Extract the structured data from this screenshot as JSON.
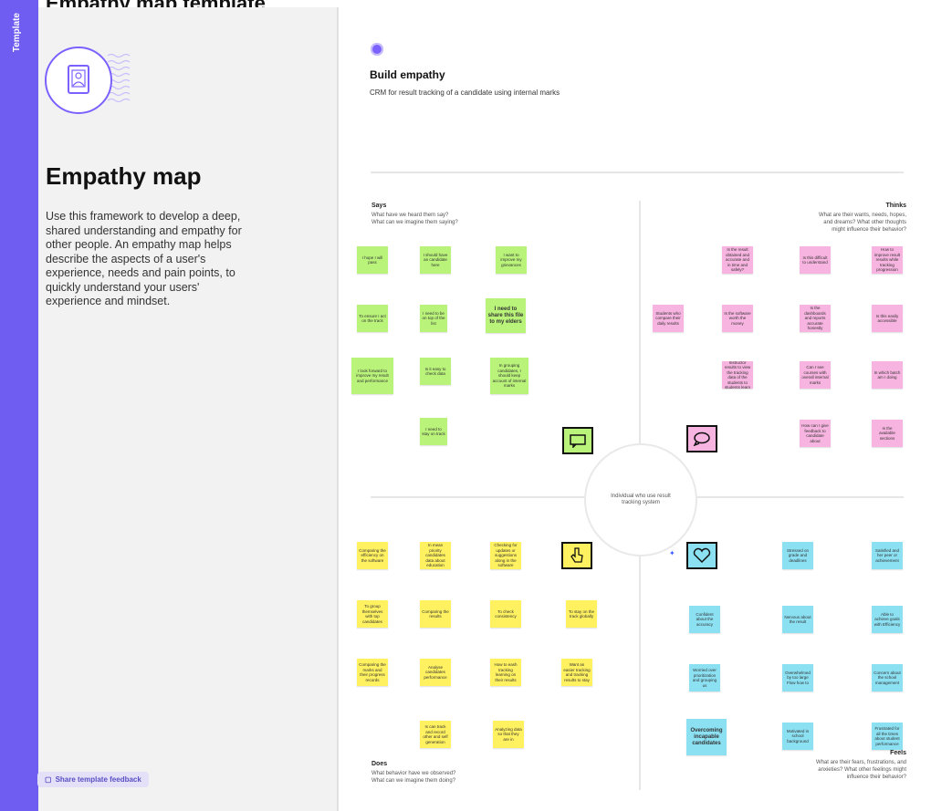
{
  "header": {
    "title": "Empathy map template"
  },
  "strip": {
    "label": "Template"
  },
  "panel": {
    "title": "Empathy map",
    "description": "Use this framework to develop a deep, shared understanding and empathy for other people. An empathy map helps describe the aspects of a user's experience, needs and pain points, to quickly understand your users' experience and mindset.",
    "feedback_button": "Share template feedback",
    "hero_icon": "user-profile-icon"
  },
  "board": {
    "title": "Build empathy",
    "subtitle": "CRM for result tracking of a candidate using internal marks",
    "center": "Individual who use result tracking system"
  },
  "quadrants": {
    "says": {
      "title": "Says",
      "desc1": "What have we heard them say?",
      "desc2": "What can we imagine them saying?"
    },
    "thinks": {
      "title": "Thinks",
      "desc1": "What are their wants, needs, hopes,",
      "desc2": "and dreams? What other thoughts",
      "desc3": "might influence their behavior?"
    },
    "does": {
      "title": "Does",
      "desc1": "What behavior have we observed?",
      "desc2": "What can we imagine them doing?"
    },
    "feels": {
      "title": "Feels",
      "desc1": "What are their fears, frustrations, and",
      "desc2": "anxieties? What other feelings might",
      "desc3": "influence their behavior?"
    }
  },
  "notes": {
    "green": [
      "I hope I will pass",
      "I should have an candidate here",
      "I want to improve my grievances",
      "To ensure I act on the track",
      "I need to be on top of the list",
      "I need to share this file to my elders",
      "I look forward to improve my result and performance",
      "Is it easy to check data",
      "In grouping candidates, I should keep account of internal marks",
      "I need to stay on track"
    ],
    "pink": [
      "Is the result obtained and accurate and in time and safely?",
      "Is this difficult to understand",
      "How to improve result results while tracking progression",
      "Students who compare their daily results",
      "Is the software worth the money",
      "Is the dashboards and reports accurate honestly",
      "Is this easily accessible",
      "Instructor results to view the tracking data of the students to students learn",
      "Can I see courses with overall internal marks",
      "In which batch am I doing",
      "How can I give feedback to candidate about",
      "Is the available sections"
    ],
    "yellow": [
      "Comparing the efficiency on the software",
      "In mean priority candidates data about education",
      "Checking for updates or suggestions along in the software",
      "To group themselves with top candidates",
      "Comparing the results",
      "To check consistency",
      "To stay on the track globally",
      "Comparing the marks and their progress records",
      "Analyse candidates performance",
      "How to eash tracking learning on their results",
      "Want an easier tracking and tracking results to stay",
      "Is can track and record other and self generation",
      "Analyzing data so that they are in"
    ],
    "blue": [
      "Stressed on grade and deadlines",
      "Satisfied and her peer or achievement",
      "Confident about the accuracy",
      "Nervous about the result",
      "Able to achieve goals with Efficiency",
      "Worried over prioritization and grouping us",
      "Overwhelmed by too large Flow how to",
      "Concern about the school management",
      "Overcoming incapable candidates",
      "Motivated in school background",
      "Frustrated for all the times about student performance"
    ]
  },
  "icons": {
    "says": "speech-note-icon",
    "thinks": "thought-bubble-icon",
    "does": "hand-pointer-icon",
    "feels": "heart-icon"
  },
  "colors": {
    "accent": "#6f5cf0",
    "green": "#b9f37a",
    "pink": "#f7b4e0",
    "yellow": "#fff160",
    "blue": "#8be0f2"
  }
}
